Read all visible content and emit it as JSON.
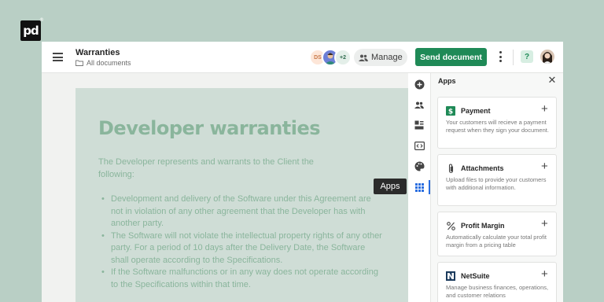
{
  "brand": {
    "logo_text": "pd"
  },
  "header": {
    "title": "Warranties",
    "breadcrumb": "All documents",
    "avatars": {
      "initials": "DS",
      "more_count": "+2"
    },
    "manage_label": "Manage",
    "send_label": "Send document",
    "help_label": "?"
  },
  "document": {
    "heading": "Developer warranties",
    "intro": "The Developer represents and warrants to the Client the following:",
    "bullets": [
      "Development and delivery of the Software under this Agreement are not in violation of any other agreement that the Developer has with another party.",
      "The Software will not violate the intellectual property rights of any other party. For a period of 10 days after the Delivery Date, the Software shall operate according to the Specifications.",
      "If the Software malfunctions or in any way does not operate according to the Specifications within that time."
    ]
  },
  "rail": {
    "tooltip": "Apps"
  },
  "panel": {
    "title": "Apps",
    "apps": [
      {
        "name": "Payment",
        "description": "Your customers will recieve a payment request when they sign your document.",
        "icon": "dollar-icon"
      },
      {
        "name": "Attachments",
        "description": "Upload files to provide your customers with additional information.",
        "icon": "paperclip-icon"
      },
      {
        "name": "Profit Margin",
        "description": "Automatically calculate your total profit margin from a pricing table",
        "icon": "percent-icon"
      },
      {
        "name": "NetSuite",
        "description": "Manage business finances, operations, and customer relations",
        "icon": "netsuite-logo-icon"
      }
    ]
  },
  "colors": {
    "accent": "#1f8a57",
    "doc_text": "#8ab59c",
    "background": "#b9cfc5"
  }
}
